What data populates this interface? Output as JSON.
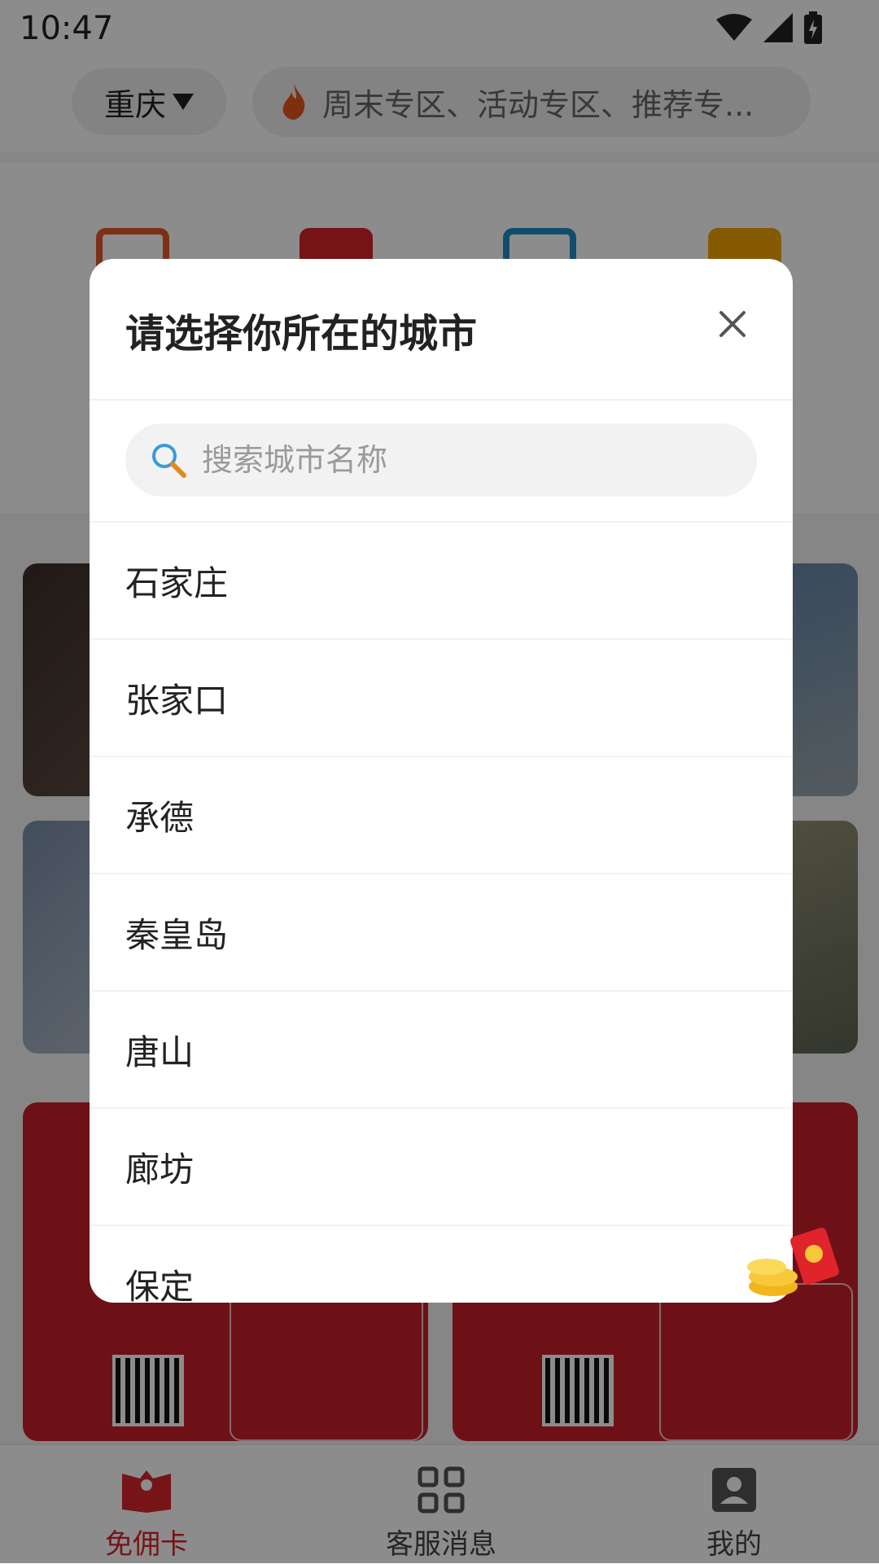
{
  "status_bar": {
    "time": "10:47"
  },
  "header": {
    "city": "重庆",
    "hot_search": "周末专区、活动专区、推荐专..."
  },
  "dialog": {
    "title": "请选择你所在的城市",
    "search_placeholder": "搜索城市名称",
    "cities": [
      "石家庄",
      "张家口",
      "承德",
      "秦皇岛",
      "唐山",
      "廊坊",
      "保定"
    ]
  },
  "tabbar": {
    "tabs": [
      {
        "label": "免佣卡",
        "icon": "map-pin-book-icon",
        "active": true
      },
      {
        "label": "客服消息",
        "icon": "grid-icon",
        "active": false
      },
      {
        "label": "我的",
        "icon": "profile-icon",
        "active": false
      }
    ]
  },
  "colors": {
    "accent": "#d7262c",
    "overlay": "rgba(0,0,0,0.45)"
  }
}
